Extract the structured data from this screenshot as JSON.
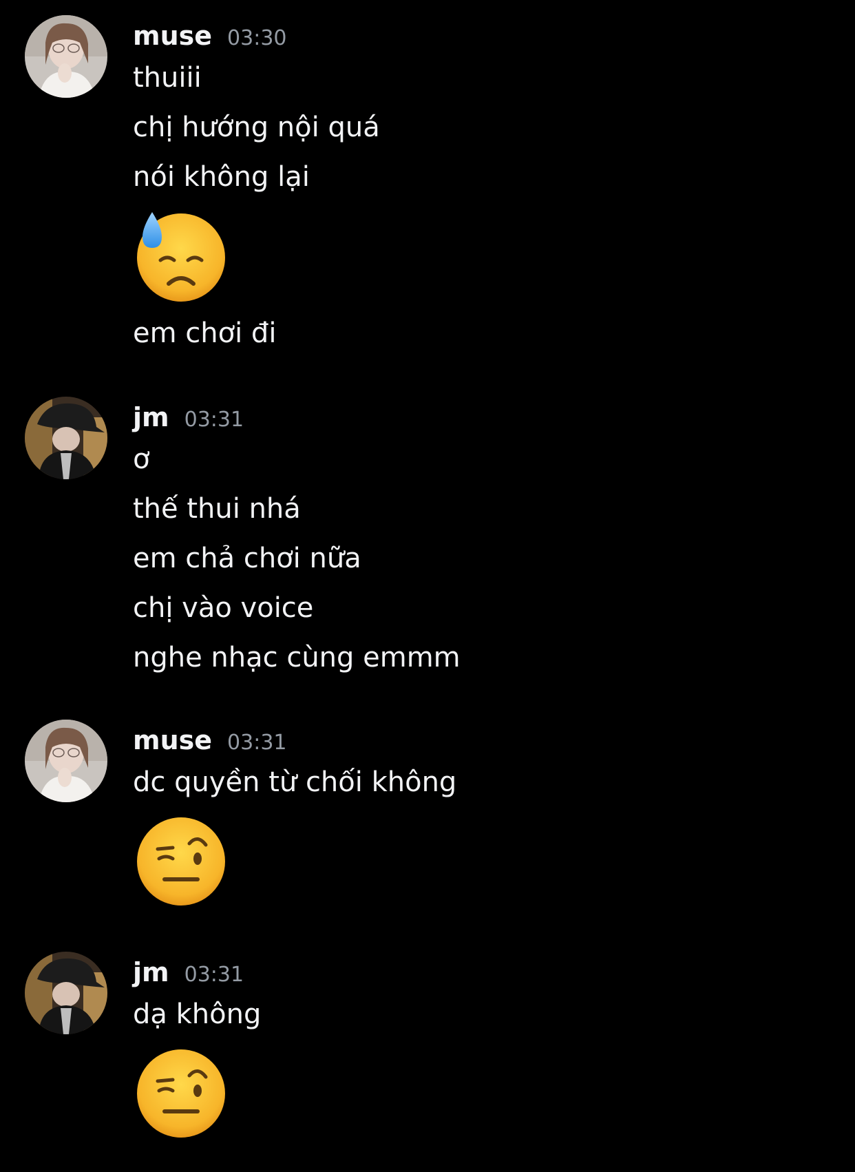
{
  "messages": [
    {
      "author": "muse",
      "time": "03:30",
      "avatar_icon": "user-avatar-muse",
      "lines": [
        "thuiii",
        "chị hướng nội quá",
        "nói không lại"
      ],
      "emoji": "downcast-face-with-sweat",
      "after_emoji": "em chơi đi"
    },
    {
      "author": "jm",
      "time": "03:31",
      "avatar_icon": "user-avatar-jm",
      "lines": [
        "ơ",
        "thế thui nhá",
        "em chả chơi nữa",
        "chị vào voice",
        "nghe nhạc cùng emmm"
      ]
    },
    {
      "author": "muse",
      "time": "03:31",
      "avatar_icon": "user-avatar-muse",
      "lines": [
        "dc quyền từ chối không"
      ],
      "emoji": "face-with-raised-eyebrow"
    },
    {
      "author": "jm",
      "time": "03:31",
      "avatar_icon": "user-avatar-jm",
      "lines": [
        "dạ không"
      ],
      "emoji": "face-with-raised-eyebrow"
    }
  ],
  "colors": {
    "background": "#000000",
    "text": "#f2f3f5",
    "timestamp": "#949ba4"
  }
}
